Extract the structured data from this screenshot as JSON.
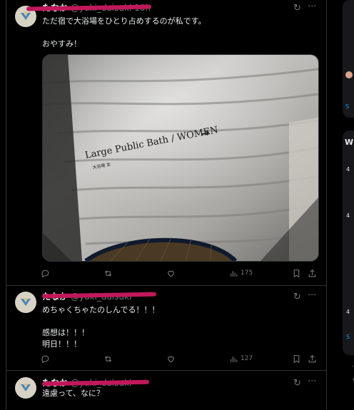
{
  "tweets": [
    {
      "name": "たなか",
      "handle": "@yuki_daisuki",
      "time": "10h",
      "text": "ただ宿で大浴場をひとり占めするのが私です。\n\nおやすみ！",
      "views": "175",
      "image": {
        "sign_en": "Large Public Bath / WOMEN",
        "sign_jp": "大浴場 女",
        "arrow": "→"
      }
    },
    {
      "name": "たなか",
      "handle": "@yuki_daisuki",
      "time": "",
      "text": "めちゃくちゃたのしんでる！！！\n\n感想は！！！\n明日！！！",
      "views": "127"
    },
    {
      "name": "たなか",
      "handle": "@yuki_daisuki",
      "time": "",
      "text": "遠慮って、なに？",
      "views": ""
    }
  ],
  "icons": {
    "reply": "reply-icon",
    "retweet": "retweet-icon",
    "like": "heart-icon",
    "views": "views-icon",
    "bookmark": "bookmark-icon",
    "share": "share-icon",
    "grok": "grok-icon",
    "more": "more-icon"
  },
  "sidebar": {
    "link": "S",
    "letters": [
      "W",
      "4",
      "4",
      "4",
      "S",
      "T",
      "A"
    ]
  },
  "colors": {
    "background": "#000000",
    "text": "#e7e9ea",
    "muted": "#71767b",
    "border": "#2f3336",
    "accent": "#1d9bf0",
    "scribble": "#c2185b"
  }
}
